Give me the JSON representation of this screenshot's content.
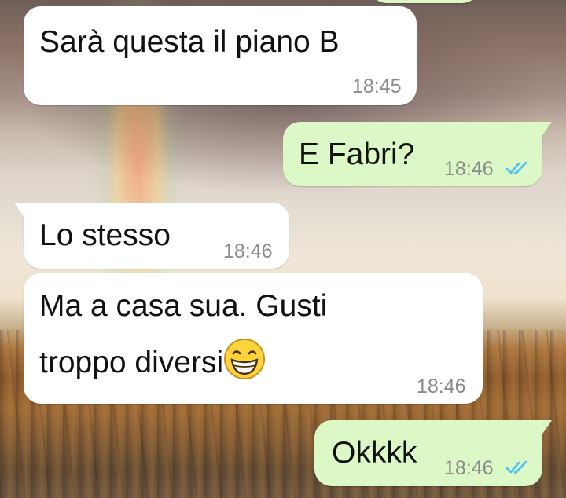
{
  "conversation": {
    "messages": [
      {
        "direction": "incoming",
        "text": "Sarà questa il piano B",
        "time": "18:45"
      },
      {
        "direction": "outgoing",
        "text": "E Fabri?",
        "time": "18:46",
        "status": "read",
        "status_icon": "double-check-icon"
      },
      {
        "direction": "incoming",
        "text": "Lo stesso",
        "time": "18:46"
      },
      {
        "direction": "incoming",
        "text_line1": "Ma a casa sua. Gusti",
        "text_line2": "troppo diversi",
        "emoji": "😁",
        "emoji_icon": "grinning-face-icon",
        "time": "18:46"
      },
      {
        "direction": "outgoing",
        "text": "Okkkk",
        "time": "18:46",
        "status": "read",
        "status_icon": "double-check-icon"
      }
    ]
  },
  "colors": {
    "incoming_bubble": "#ffffff",
    "outgoing_bubble": "#dcf8c6",
    "timestamp": "#8a8a8a",
    "read_ticks": "#4fc3f7"
  }
}
